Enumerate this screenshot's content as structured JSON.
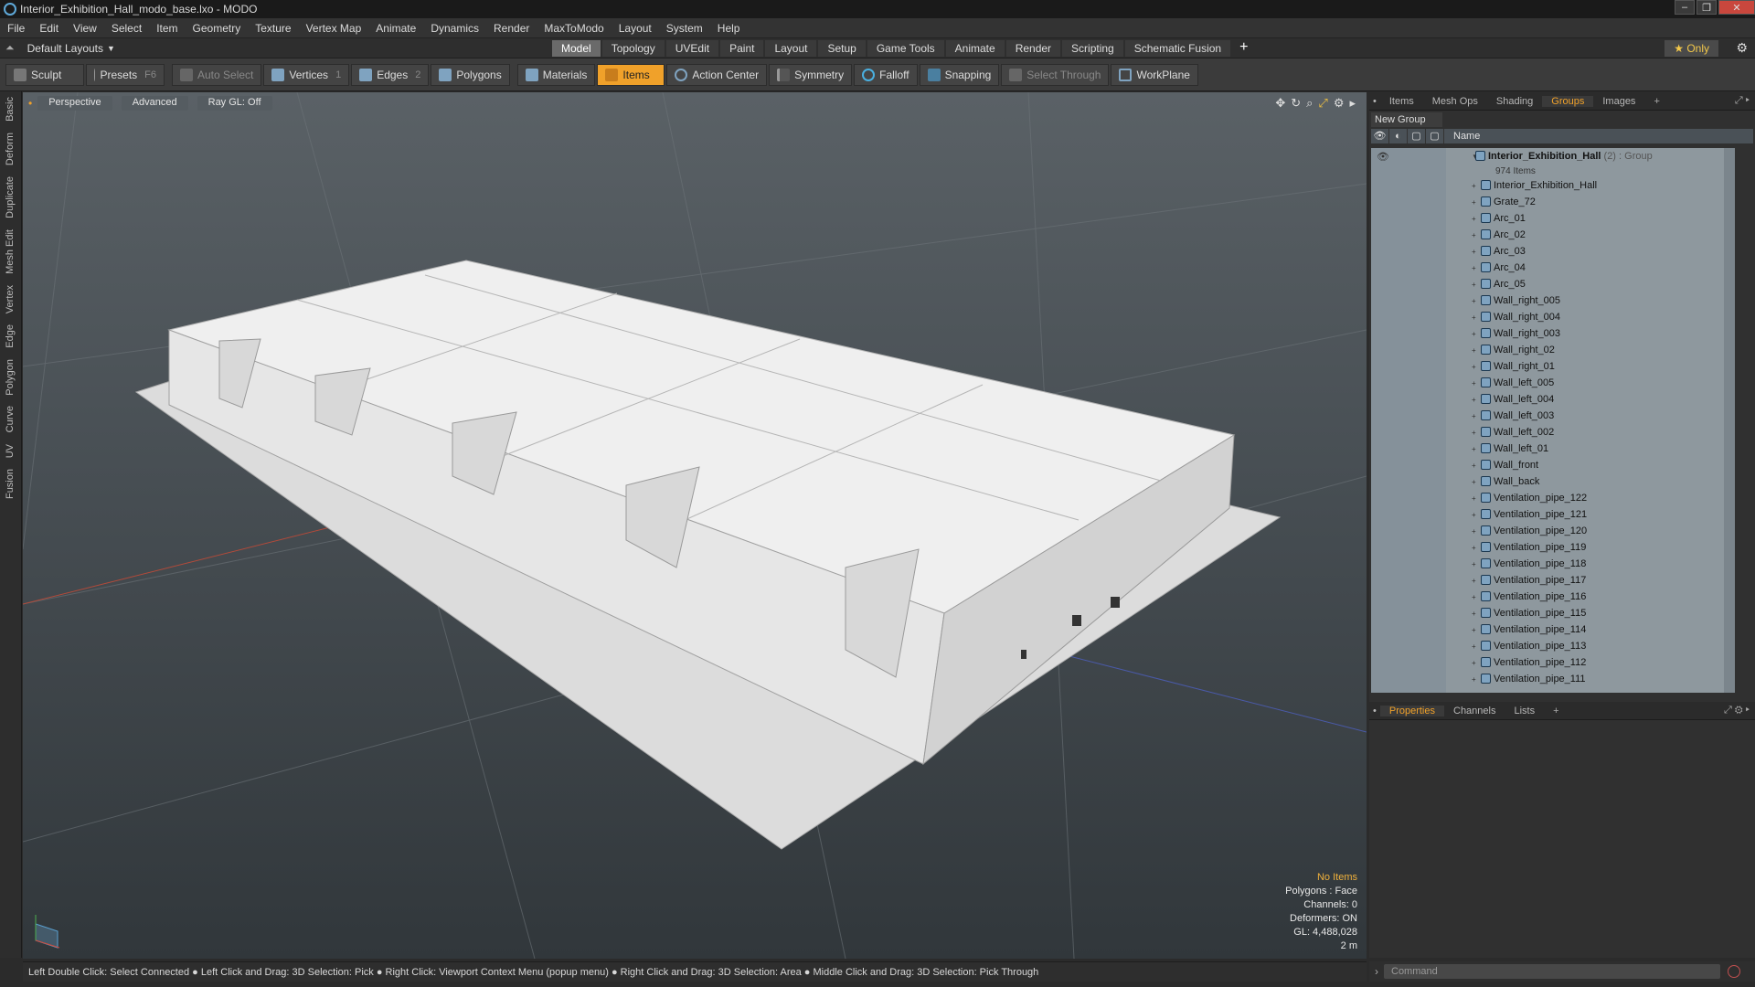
{
  "window": {
    "title": "Interior_Exhibition_Hall_modo_base.lxo - MODO",
    "controls": [
      "–",
      "❐",
      "✕"
    ]
  },
  "menu": [
    "File",
    "Edit",
    "View",
    "Select",
    "Item",
    "Geometry",
    "Texture",
    "Vertex Map",
    "Animate",
    "Dynamics",
    "Render",
    "MaxToModo",
    "Layout",
    "System",
    "Help"
  ],
  "layoutbar": {
    "layout_dropdown": "Default Layouts",
    "tabs": [
      "Model",
      "Topology",
      "UVEdit",
      "Paint",
      "Layout",
      "Setup",
      "Game Tools",
      "Animate",
      "Render",
      "Scripting",
      "Schematic Fusion"
    ],
    "active_tab": "Model",
    "only_label": "★  Only"
  },
  "toolbar": {
    "sculpt": "Sculpt",
    "presets": "Presets",
    "presets_key": "F6",
    "auto_select": "Auto Select",
    "vertices": "Vertices",
    "vertices_key": "1",
    "edges": "Edges",
    "edges_key": "2",
    "polygons": "Polygons",
    "materials": "Materials",
    "items": "Items",
    "action_center": "Action Center",
    "symmetry": "Symmetry",
    "falloff": "Falloff",
    "snapping": "Snapping",
    "select_through": "Select Through",
    "workplane": "WorkPlane"
  },
  "left_tabs": [
    "Basic",
    "Deform",
    "Duplicate",
    "Mesh Edit",
    "Vertex",
    "Edge",
    "Polygon",
    "Curve",
    "UV",
    "Fusion"
  ],
  "viewport": {
    "view_mode": "Perspective",
    "shading": "Advanced",
    "raygl": "Ray GL: Off",
    "info": {
      "items": "No Items",
      "polygons": "Polygons : Face",
      "channels": "Channels: 0",
      "deformers": "Deformers: ON",
      "gl": "GL: 4,488,028",
      "scale": "2 m"
    }
  },
  "status": "Left Double Click: Select Connected ● Left Click and Drag: 3D Selection: Pick ● Right Click: Viewport Context Menu (popup menu) ● Right Click and Drag: 3D Selection: Area ● Middle Click and Drag: 3D Selection: Pick Through",
  "right_panel": {
    "tabs": [
      "Items",
      "Mesh Ops",
      "Shading",
      "Groups",
      "Images"
    ],
    "active_tab": "Groups",
    "new_group": "New Group",
    "column_name": "Name",
    "group": {
      "name": "Interior_Exhibition_Hall",
      "count": "(2)",
      "type": ": Group",
      "sub": "974 Items"
    },
    "items": [
      "Interior_Exhibition_Hall",
      "Grate_72",
      "Arc_01",
      "Arc_02",
      "Arc_03",
      "Arc_04",
      "Arc_05",
      "Wall_right_005",
      "Wall_right_004",
      "Wall_right_003",
      "Wall_right_02",
      "Wall_right_01",
      "Wall_left_005",
      "Wall_left_004",
      "Wall_left_003",
      "Wall_left_002",
      "Wall_left_01",
      "Wall_front",
      "Wall_back",
      "Ventilation_pipe_122",
      "Ventilation_pipe_121",
      "Ventilation_pipe_120",
      "Ventilation_pipe_119",
      "Ventilation_pipe_118",
      "Ventilation_pipe_117",
      "Ventilation_pipe_116",
      "Ventilation_pipe_115",
      "Ventilation_pipe_114",
      "Ventilation_pipe_113",
      "Ventilation_pipe_112",
      "Ventilation_pipe_111"
    ]
  },
  "props_tabs": [
    "Properties",
    "Channels",
    "Lists"
  ],
  "props_active": "Properties",
  "command_placeholder": "Command",
  "colors": {
    "accent": "#f0a12a",
    "list_bg": "#8e989e",
    "viewport_top": "#5a6166"
  }
}
